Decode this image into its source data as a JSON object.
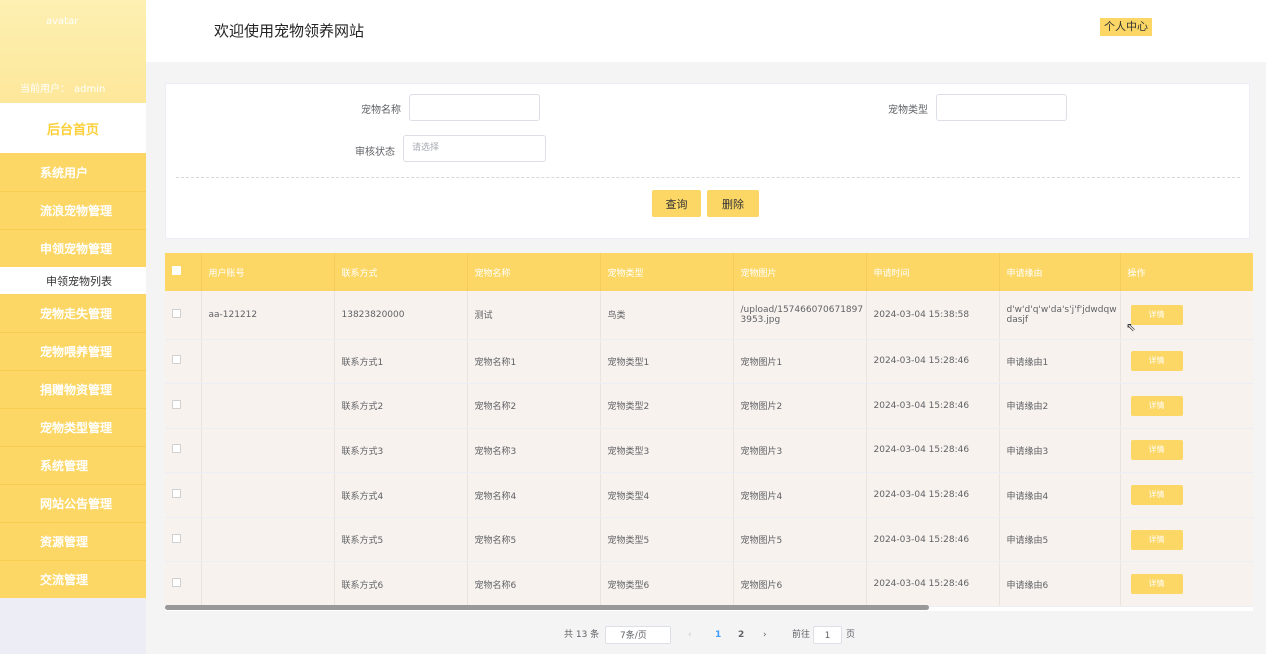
{
  "sidebar": {
    "avatar_alt": "avatar",
    "current_user_label": "当前用户：",
    "current_user_name": "admin",
    "home": "后台首页",
    "menu": [
      "系统用户",
      "流浪宠物管理",
      "申领宠物管理",
      "申领宠物列表",
      "宠物走失管理",
      "宠物喂养管理",
      "捐赠物资管理",
      "宠物类型管理",
      "系统管理",
      "网站公告管理",
      "资源管理",
      "交流管理"
    ]
  },
  "header": {
    "title": "欢迎使用宠物领养网站",
    "personal_center": "个人中心"
  },
  "search": {
    "pet_name_label": "宠物名称",
    "pet_type_label": "宠物类型",
    "audit_status_label": "审核状态",
    "audit_status_placeholder": "请选择",
    "query_button": "查询",
    "delete_button": "删除"
  },
  "table": {
    "columns": [
      "用户账号",
      "联系方式",
      "宠物名称",
      "宠物类型",
      "宠物图片",
      "申请时间",
      "申请缘由",
      "操作"
    ],
    "detail_label": "详情",
    "rows": [
      {
        "account": "aa-121212",
        "contact": "13823820000",
        "name": "测试",
        "type": "鸟类",
        "image": "/upload/1574660706718973953.jpg",
        "time": "2024-03-04 15:38:58",
        "reason": "d'w'd'q'w'da's'j'f'jdwdqwdasjf"
      },
      {
        "account": "",
        "contact": "联系方式1",
        "name": "宠物名称1",
        "type": "宠物类型1",
        "image": "宠物图片1",
        "time": "2024-03-04 15:28:46",
        "reason": "申请缘由1"
      },
      {
        "account": "",
        "contact": "联系方式2",
        "name": "宠物名称2",
        "type": "宠物类型2",
        "image": "宠物图片2",
        "time": "2024-03-04 15:28:46",
        "reason": "申请缘由2"
      },
      {
        "account": "",
        "contact": "联系方式3",
        "name": "宠物名称3",
        "type": "宠物类型3",
        "image": "宠物图片3",
        "time": "2024-03-04 15:28:46",
        "reason": "申请缘由3"
      },
      {
        "account": "",
        "contact": "联系方式4",
        "name": "宠物名称4",
        "type": "宠物类型4",
        "image": "宠物图片4",
        "time": "2024-03-04 15:28:46",
        "reason": "申请缘由4"
      },
      {
        "account": "",
        "contact": "联系方式5",
        "name": "宠物名称5",
        "type": "宠物类型5",
        "image": "宠物图片5",
        "time": "2024-03-04 15:28:46",
        "reason": "申请缘由5"
      },
      {
        "account": "",
        "contact": "联系方式6",
        "name": "宠物名称6",
        "type": "宠物类型6",
        "image": "宠物图片6",
        "time": "2024-03-04 15:28:46",
        "reason": "申请缘由6"
      }
    ]
  },
  "pagination": {
    "total": "共 13 条",
    "page_size": "7条/页",
    "prev": "‹",
    "pages": [
      "1",
      "2"
    ],
    "next": "›",
    "goto_label": "前往",
    "goto_value": "1",
    "page_unit": "页"
  },
  "colors": {
    "accent": "#fcd765",
    "sidebar_profile": "#fde79a",
    "row_bg": "#f8f2ee",
    "active_page": "#409eff"
  }
}
